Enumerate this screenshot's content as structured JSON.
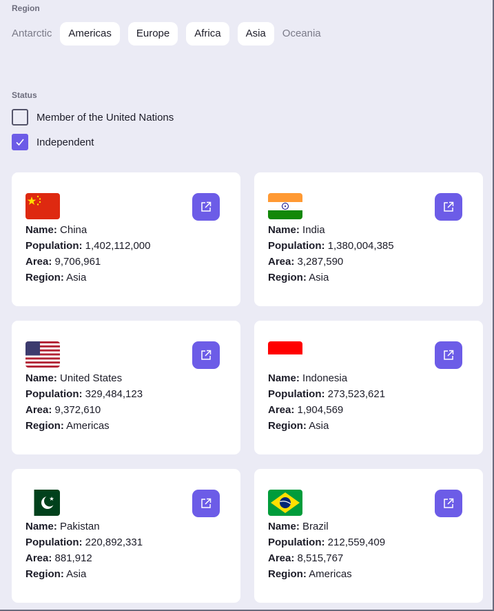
{
  "filters": {
    "region_label": "Region",
    "regions": [
      {
        "label": "Antarctic",
        "style": "inactive"
      },
      {
        "label": "Americas",
        "style": "chip"
      },
      {
        "label": "Europe",
        "style": "chip"
      },
      {
        "label": "Africa",
        "style": "chip"
      },
      {
        "label": "Asia",
        "style": "chip"
      },
      {
        "label": "Oceania",
        "style": "inactive"
      }
    ],
    "status_label": "Status",
    "status": [
      {
        "label": "Member of the United Nations",
        "checked": false
      },
      {
        "label": "Independent",
        "checked": true
      }
    ]
  },
  "field_labels": {
    "name": "Name:",
    "population": "Population:",
    "area": "Area:",
    "region": "Region:"
  },
  "countries": [
    {
      "name": "China",
      "population": "1,402,112,000",
      "area": "9,706,961",
      "region": "Asia",
      "flag_icon": "china-flag-icon"
    },
    {
      "name": "India",
      "population": "1,380,004,385",
      "area": "3,287,590",
      "region": "Asia",
      "flag_icon": "india-flag-icon"
    },
    {
      "name": "United States",
      "population": "329,484,123",
      "area": "9,372,610",
      "region": "Americas",
      "flag_icon": "usa-flag-icon"
    },
    {
      "name": "Indonesia",
      "population": "273,523,621",
      "area": "1,904,569",
      "region": "Asia",
      "flag_icon": "indonesia-flag-icon"
    },
    {
      "name": "Pakistan",
      "population": "220,892,331",
      "area": "881,912",
      "region": "Asia",
      "flag_icon": "pakistan-flag-icon"
    },
    {
      "name": "Brazil",
      "population": "212,559,409",
      "area": "8,515,767",
      "region": "Americas",
      "flag_icon": "brazil-flag-icon"
    }
  ],
  "colors": {
    "accent": "#6c5ce7",
    "background": "#ebebf5",
    "card": "#ffffff"
  }
}
